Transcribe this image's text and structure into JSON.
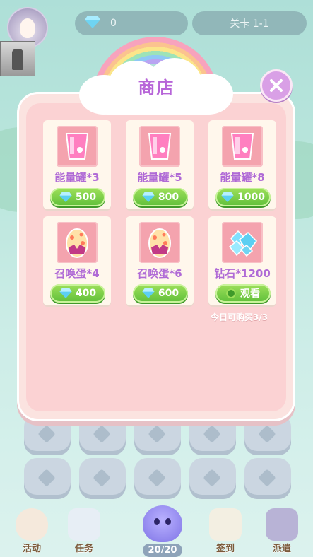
{
  "topbar": {
    "gems": "0",
    "level": "关卡 1-1"
  },
  "shop": {
    "title": "商店",
    "items": [
      {
        "name": "能量罐*3",
        "icon": "energy-can-icon",
        "price": "500"
      },
      {
        "name": "能量罐*5",
        "icon": "energy-can-icon",
        "price": "800"
      },
      {
        "name": "能量罐*8",
        "icon": "energy-can-icon",
        "price": "1000"
      },
      {
        "name": "召唤蛋*4",
        "icon": "summon-egg-icon",
        "price": "400"
      },
      {
        "name": "召唤蛋*6",
        "icon": "summon-egg-icon",
        "price": "600"
      },
      {
        "name": "钻石*1200",
        "icon": "diamond-icon",
        "action": "观看"
      }
    ],
    "daily_limit": "今日可购买3/3"
  },
  "bottom_nav": {
    "activity": "活动",
    "tasks": "任务",
    "progress": "20/20",
    "checkin": "签到",
    "dispatch": "派遣"
  },
  "colors": {
    "title": "#b765d8",
    "label": "#b06ad6",
    "button_green": "#5fbf3a",
    "panel": "#fbd2d3"
  }
}
